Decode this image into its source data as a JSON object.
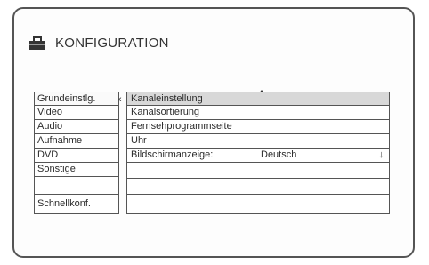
{
  "header": {
    "title": "KONFIGURATION",
    "icon": "toolbox-icon"
  },
  "menu": {
    "items": [
      {
        "label": "Grundeinstlg."
      },
      {
        "label": "Video"
      },
      {
        "label": "Audio"
      },
      {
        "label": "Aufnahme"
      },
      {
        "label": "DVD"
      },
      {
        "label": "Sonstige"
      },
      {
        "label": ""
      },
      {
        "label": "Schnellkonf."
      }
    ]
  },
  "submenu": {
    "rows": [
      {
        "label": "Kanaleinstellung",
        "value": ""
      },
      {
        "label": "Kanalsortierung",
        "value": ""
      },
      {
        "label": "Fernsehprogrammseite",
        "value": ""
      },
      {
        "label": "Uhr",
        "value": ""
      },
      {
        "label": "Bildschirmanzeige:",
        "value": "Deutsch"
      }
    ],
    "down_arrow": "↓"
  }
}
